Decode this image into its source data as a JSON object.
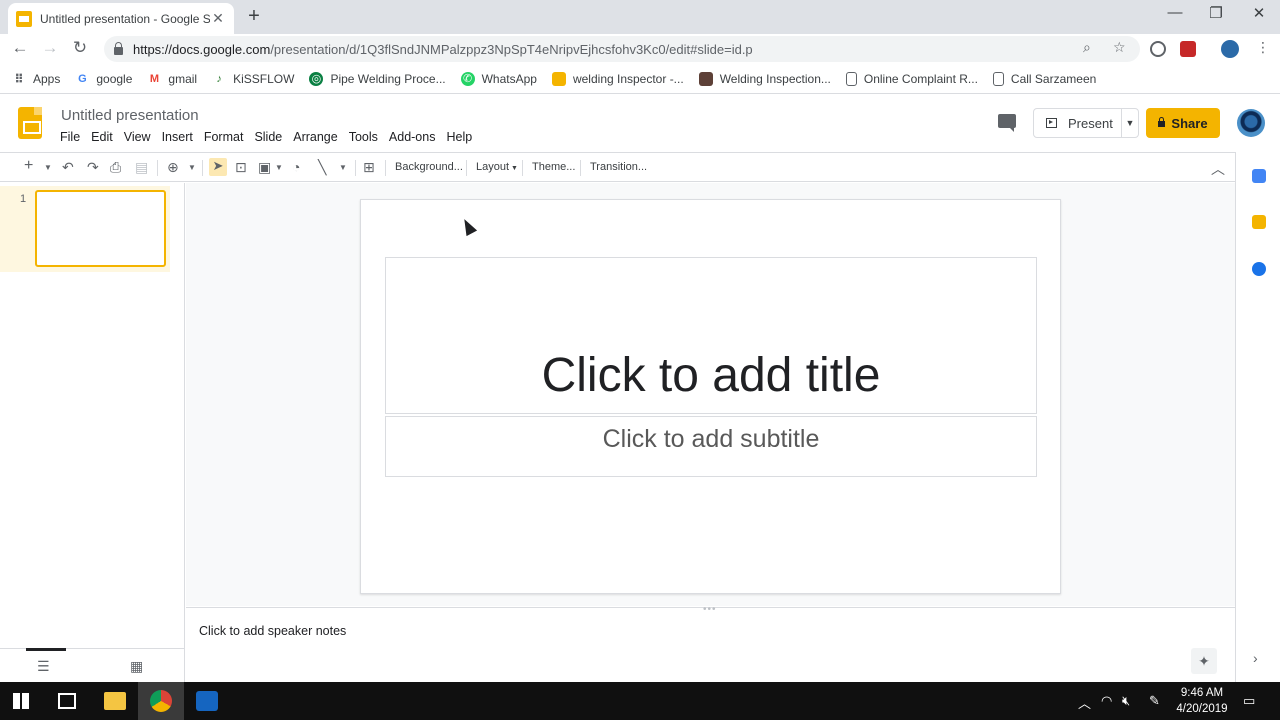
{
  "browser": {
    "tab_title": "Untitled presentation - Google Slides",
    "new_tab": "+",
    "url_host": "https://docs.google.com",
    "url_path": "/presentation/d/1Q3flSndJNMPalzppz3NpSpT4eNripvEjhcsfohv3Kc0/edit#slide=id.p",
    "bookmarks": [
      {
        "label": "Apps",
        "icon": "apps-grid-icon"
      },
      {
        "label": "google",
        "icon": "google-icon"
      },
      {
        "label": "gmail",
        "icon": "gmail-icon"
      },
      {
        "label": "KiSSFLOW",
        "icon": "kissflow-icon"
      },
      {
        "label": "Pipe Welding Proce...",
        "icon": "globe-icon"
      },
      {
        "label": "WhatsApp",
        "icon": "whatsapp-icon"
      },
      {
        "label": "welding Inspector -...",
        "icon": "folder-icon"
      },
      {
        "label": "Welding Inspection...",
        "icon": "image-icon"
      },
      {
        "label": "Online Complaint R...",
        "icon": "page-icon"
      },
      {
        "label": "Call Sarzameen",
        "icon": "page-icon"
      }
    ]
  },
  "app": {
    "doc_title": "Untitled presentation",
    "menus": [
      "File",
      "Edit",
      "View",
      "Insert",
      "Format",
      "Slide",
      "Arrange",
      "Tools",
      "Add-ons",
      "Help"
    ],
    "present_label": "Present",
    "share_label": "Share",
    "toolbar": {
      "background": "Background...",
      "layout": "Layout",
      "theme": "Theme...",
      "transition": "Transition..."
    }
  },
  "filmstrip": {
    "slide_number": "1"
  },
  "slide": {
    "title_placeholder": "Click to add title",
    "subtitle_placeholder": "Click to add subtitle"
  },
  "notes": {
    "placeholder": "Click to add speaker notes"
  },
  "taskbar": {
    "time": "9:46 AM",
    "date": "4/20/2019"
  },
  "colors": {
    "accent": "#f4b400",
    "selection": "#fef7e0"
  }
}
